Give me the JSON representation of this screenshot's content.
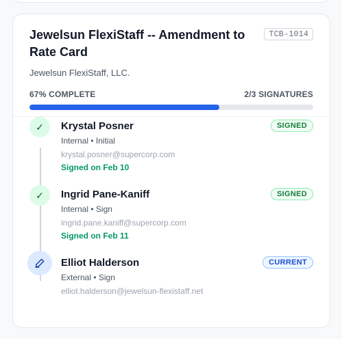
{
  "document": {
    "title": "Jewelsun FlexiStaff -- Amendment to Rate Card",
    "reference": "TCB-1014",
    "company": "Jewelsun FlexiStaff, LLC."
  },
  "progress": {
    "percent_label": "67% COMPLETE",
    "signatures_label": "2/3 SIGNATURES",
    "fraction": 0.67,
    "color": "#2563eb"
  },
  "signers": [
    {
      "name": "Krystal Posner",
      "role": "Internal • Initial",
      "email": "krystal.posner@supercorp.com",
      "signed_on": "Signed on Feb 10",
      "status": "SIGNED",
      "icon": "check-icon"
    },
    {
      "name": "Ingrid Pane-Kaniff",
      "role": "Internal • Sign",
      "email": "ingrid.pane.kaniff@supercorp.com",
      "signed_on": "Signed on Feb 11",
      "status": "SIGNED",
      "icon": "check-icon"
    },
    {
      "name": "Elliot Halderson",
      "role": "External • Sign",
      "email": "elliot.halderson@jewelsun-flexistaff.net",
      "status": "CURRENT",
      "icon": "pen-icon"
    }
  ]
}
